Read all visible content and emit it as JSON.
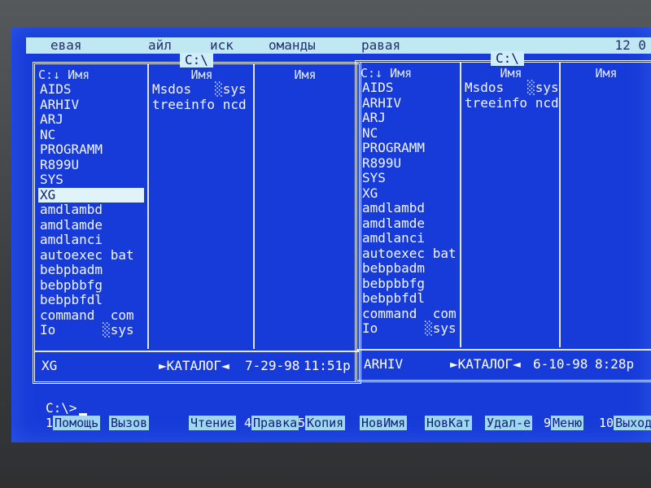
{
  "menubar": {
    "items": [
      "евая",
      "айл",
      "иск",
      "оманды",
      "равая"
    ],
    "clock": "12 0"
  },
  "left_panel": {
    "drive": "C:\\",
    "col_headers": [
      "C:↓ Имя",
      "Имя",
      "Имя"
    ],
    "col1": [
      "AIDS",
      "ARHIV",
      "ARJ",
      "NC",
      "PROGRAMM",
      "R899U",
      "SYS",
      "XG",
      "amdlambd",
      "amdlamde",
      "amdlanci",
      "autoexec bat",
      "bebpbadm",
      "bebpbbfg",
      "bebpbfdl",
      "command  com",
      "Io      ░sys"
    ],
    "selected_index": 7,
    "col2": [
      "Msdos   ░sys",
      "treeinfo ncd"
    ],
    "status": {
      "name": "XG",
      "type": "►КАТАЛОГ◄",
      "date": "7-29-98",
      "time": "11:51p"
    }
  },
  "right_panel": {
    "drive": "C:\\",
    "col_headers": [
      "C:↓ Имя",
      "Имя",
      "Имя"
    ],
    "col1": [
      "AIDS",
      "ARHIV",
      "ARJ",
      "NC",
      "PROGRAMM",
      "R899U",
      "SYS",
      "XG",
      "amdlambd",
      "amdlamde",
      "amdlanci",
      "autoexec bat",
      "bebpbadm",
      "bebpbbfg",
      "bebpbfdl",
      "command  com",
      "Io      ░sys"
    ],
    "col2": [
      "Msdos   ░sys",
      "treeinfo ncd"
    ],
    "status": {
      "name": "ARHIV",
      "type": "►КАТАЛОГ◄",
      "date": "6-10-98",
      "time": "8:28p"
    }
  },
  "prompt": "C:\\>",
  "fkeys": [
    {
      "num": "1",
      "label": "Помощь"
    },
    {
      "num": "",
      "label": "Вызов"
    },
    {
      "num": "",
      "label": "Чтение"
    },
    {
      "num": "4",
      "label": "Правка"
    },
    {
      "num": "5",
      "label": "Копия"
    },
    {
      "num": "",
      "label": "НовИмя"
    },
    {
      "num": "",
      "label": "НовКат"
    },
    {
      "num": "",
      "label": "Удал-е"
    },
    {
      "num": "9",
      "label": "Меню"
    },
    {
      "num": "10",
      "label": "Выход"
    }
  ],
  "colors": {
    "screen_blue": "#173bd8",
    "menubar": "#bfe8f2",
    "highlight": "#dff3f8"
  }
}
